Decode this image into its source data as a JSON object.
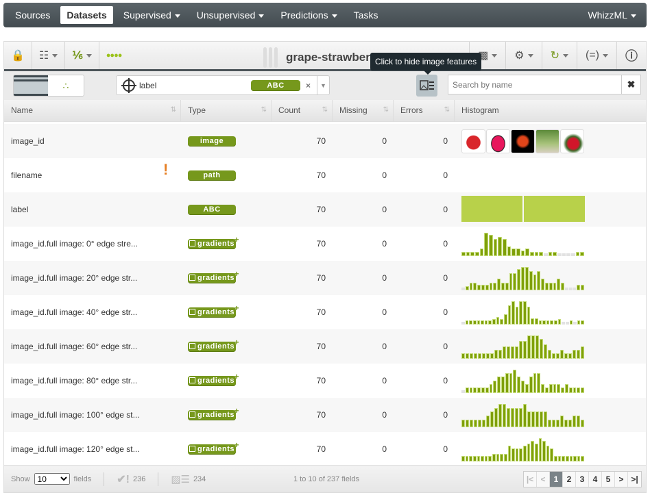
{
  "nav": {
    "items": [
      {
        "label": "Sources",
        "caret": false
      },
      {
        "label": "Datasets",
        "caret": false,
        "active": true
      },
      {
        "label": "Supervised",
        "caret": true
      },
      {
        "label": "Unsupervised",
        "caret": true
      },
      {
        "label": "Predictions",
        "caret": true
      },
      {
        "label": "Tasks",
        "caret": false
      }
    ],
    "right": "WhizzML"
  },
  "toolbar": {
    "title": "grape-strawberry",
    "tooltip": "Click to hide image features"
  },
  "filter": {
    "objective": "label",
    "objective_type": "ABC",
    "search_placeholder": "Search by name"
  },
  "table": {
    "headers": [
      "Name",
      "Type",
      "Count",
      "Missing",
      "Errors",
      "Histogram"
    ],
    "rows": [
      {
        "name": "image_id",
        "type": "image",
        "count": "70",
        "missing": "0",
        "errors": "0",
        "hist": "thumbs"
      },
      {
        "name": "filename",
        "type": "path",
        "count": "70",
        "missing": "0",
        "errors": "0",
        "warning": "!",
        "hist": "none"
      },
      {
        "name": "label",
        "type": "ABC",
        "count": "70",
        "missing": "0",
        "errors": "0",
        "hist": "categories",
        "values": [
          35,
          35
        ]
      },
      {
        "name": "image_id.full image: 0° edge stre...",
        "type": "gradients",
        "count": "70",
        "missing": "0",
        "errors": "0",
        "values": [
          1,
          1,
          1,
          1,
          2,
          6,
          5.5,
          4.5,
          5,
          4.5,
          2.5,
          2,
          2,
          1.5,
          2,
          1,
          1,
          1,
          0,
          1,
          1,
          0,
          0,
          0,
          0,
          1,
          1
        ]
      },
      {
        "name": "image_id.full image: 20° edge str...",
        "type": "gradients",
        "count": "70",
        "missing": "0",
        "errors": "0",
        "values": [
          0,
          1,
          2,
          2,
          1.5,
          1.5,
          1.5,
          2,
          2,
          3,
          2,
          2,
          4.5,
          4.5,
          5.5,
          6,
          6,
          5,
          4,
          5,
          3,
          2,
          2,
          2,
          3,
          2,
          0,
          0,
          0,
          1.5,
          1.5
        ]
      },
      {
        "name": "image_id.full image: 40° edge str...",
        "type": "gradients",
        "count": "70",
        "missing": "0",
        "errors": "0",
        "values": [
          0,
          1,
          1,
          1,
          1,
          1,
          1,
          1,
          2,
          3,
          2,
          4,
          7.5,
          9,
          7,
          9,
          9,
          7,
          2.5,
          2.5,
          1,
          1,
          1,
          1,
          1,
          2,
          0,
          0,
          1,
          0,
          1,
          1
        ]
      },
      {
        "name": "image_id.full image: 60° edge str...",
        "type": "gradients",
        "count": "70",
        "missing": "0",
        "errors": "0",
        "values": [
          1.5,
          1.5,
          1.5,
          1.5,
          1.5,
          1.5,
          1.5,
          1.5,
          2.5,
          2.5,
          3.5,
          3.5,
          3.5,
          3.5,
          5,
          5,
          6.5,
          6.5,
          6.5,
          5.5,
          4,
          2.5,
          1.5,
          1.5,
          2.5,
          1.5,
          1.5,
          2.5,
          2.5,
          3.5
        ]
      },
      {
        "name": "image_id.full image: 80° edge str...",
        "type": "gradients",
        "count": "70",
        "missing": "0",
        "errors": "0",
        "values": [
          0,
          1.5,
          1.5,
          1.5,
          1.5,
          1.5,
          1.5,
          2.5,
          3.5,
          4.5,
          4.5,
          5.5,
          5.5,
          6.5,
          4.5,
          3.5,
          2.5,
          4.5,
          5.5,
          5.5,
          2.5,
          1.5,
          2.5,
          2.5,
          2.5,
          1.5,
          2.5,
          1.5,
          1.5,
          1.5,
          1.5
        ]
      },
      {
        "name": "image_id.full image: 100° edge st...",
        "type": "gradients",
        "count": "70",
        "missing": "0",
        "errors": "0",
        "values": [
          2,
          2,
          2,
          2,
          2,
          2,
          3,
          4,
          5,
          6,
          6,
          5,
          5,
          5,
          5,
          6,
          4,
          4,
          4,
          4,
          4,
          2,
          2,
          2,
          3,
          2,
          2,
          3,
          3,
          2
        ]
      },
      {
        "name": "image_id.full image: 120° edge st...",
        "type": "gradients",
        "count": "70",
        "missing": "0",
        "errors": "0",
        "values": [
          1,
          1,
          1,
          1,
          1,
          1,
          1,
          1,
          1.5,
          1.5,
          1.5,
          1.5,
          3,
          2.5,
          2.5,
          2.5,
          3,
          3.5,
          4,
          3.5,
          4.5,
          4,
          3,
          2.5,
          1,
          1,
          1,
          1,
          1,
          1,
          1,
          1
        ]
      }
    ]
  },
  "footer": {
    "show": "Show",
    "show_value": "10",
    "fields": "fields",
    "preferred": "236",
    "image_fields": "234",
    "range": "1 to 10 of 237 fields",
    "pages": [
      "1",
      "2",
      "3",
      "4",
      "5"
    ],
    "current_page": "1"
  },
  "colors": {
    "bar": "#7fa00a",
    "category": "#b8d14a",
    "badge": "#76981c",
    "zero": "#e2e2e2"
  }
}
